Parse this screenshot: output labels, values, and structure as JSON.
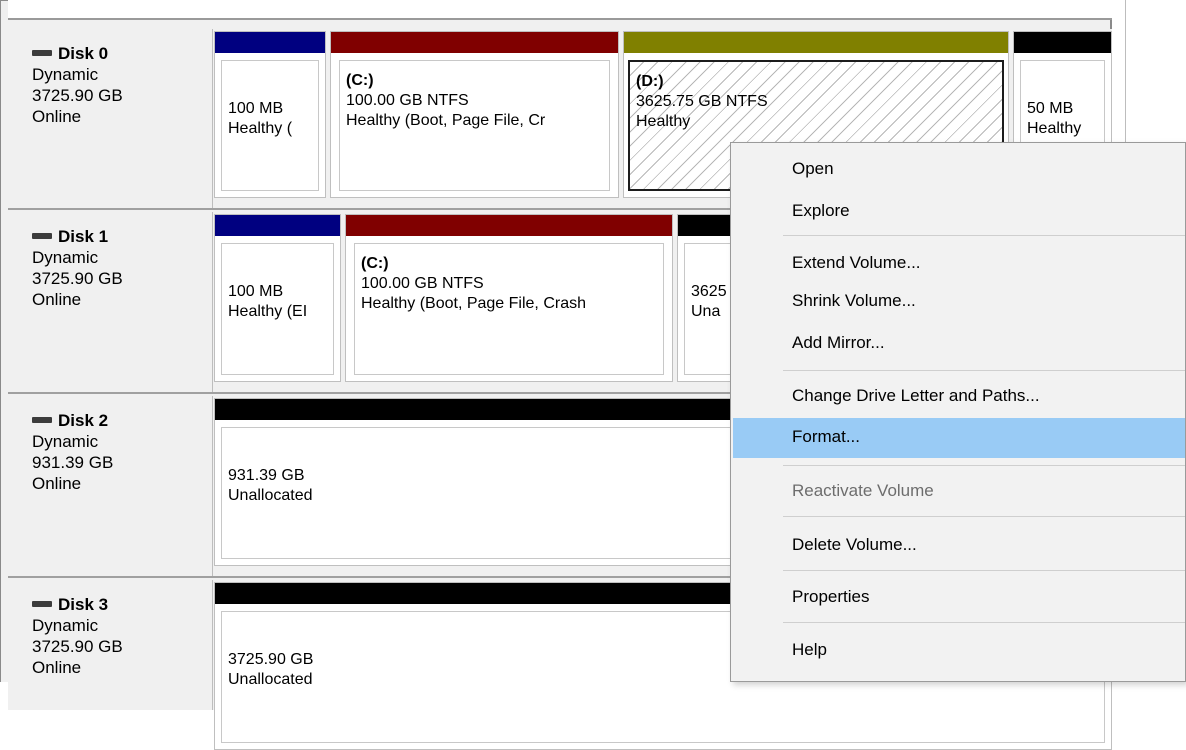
{
  "disks": [
    {
      "name": "Disk 0",
      "type": "Dynamic",
      "size": "3725.90 GB",
      "status": "Online",
      "volumes": [
        {
          "label": "",
          "size": "100 MB",
          "status": "Healthy (",
          "bar_color": "#000080"
        },
        {
          "label": "(C:)",
          "size": "100.00 GB NTFS",
          "status": "Healthy (Boot, Page File, Cr",
          "bar_color": "#800000"
        },
        {
          "label": "(D:)",
          "size": "3625.75 GB NTFS",
          "status": "Healthy",
          "bar_color": "#808000",
          "selected": true
        },
        {
          "label": "",
          "size": "50 MB",
          "status": "Healthy",
          "bar_color": "#000000"
        }
      ]
    },
    {
      "name": "Disk 1",
      "type": "Dynamic",
      "size": "3725.90 GB",
      "status": "Online",
      "volumes": [
        {
          "label": "",
          "size": "100 MB",
          "status": "Healthy (EI",
          "bar_color": "#000080"
        },
        {
          "label": "(C:)",
          "size": "100.00 GB NTFS",
          "status": "Healthy (Boot, Page File, Crash",
          "bar_color": "#800000"
        },
        {
          "label": "",
          "size": "3625",
          "status": "Una",
          "bar_color": "#000000"
        }
      ]
    },
    {
      "name": "Disk 2",
      "type": "Dynamic",
      "size": "931.39 GB",
      "status": "Online",
      "volumes": [
        {
          "label": "",
          "size": "931.39 GB",
          "status": "Unallocated",
          "bar_color": "#000000"
        }
      ]
    },
    {
      "name": "Disk 3",
      "type": "Dynamic",
      "size": "3725.90 GB",
      "status": "Online",
      "volumes": [
        {
          "label": "",
          "size": "3725.90 GB",
          "status": "Unallocated",
          "bar_color": "#000000"
        }
      ]
    }
  ],
  "context_menu": {
    "items": {
      "open": "Open",
      "explore": "Explore",
      "extend_volume": "Extend Volume...",
      "shrink_volume": "Shrink Volume...",
      "add_mirror": "Add Mirror...",
      "change_drive_letter": "Change Drive Letter and Paths...",
      "format": "Format...",
      "reactivate_volume": "Reactivate Volume",
      "delete_volume": "Delete Volume...",
      "properties": "Properties",
      "help": "Help"
    },
    "highlighted_item": "Format...",
    "disabled_items": [
      "Reactivate Volume"
    ],
    "highlight_color": "#99cbf5"
  },
  "colors": {
    "primary_partition_bar": "#000080",
    "boot_volume_bar": "#800000",
    "data_volume_bar": "#808000",
    "unallocated_bar": "#000000"
  }
}
